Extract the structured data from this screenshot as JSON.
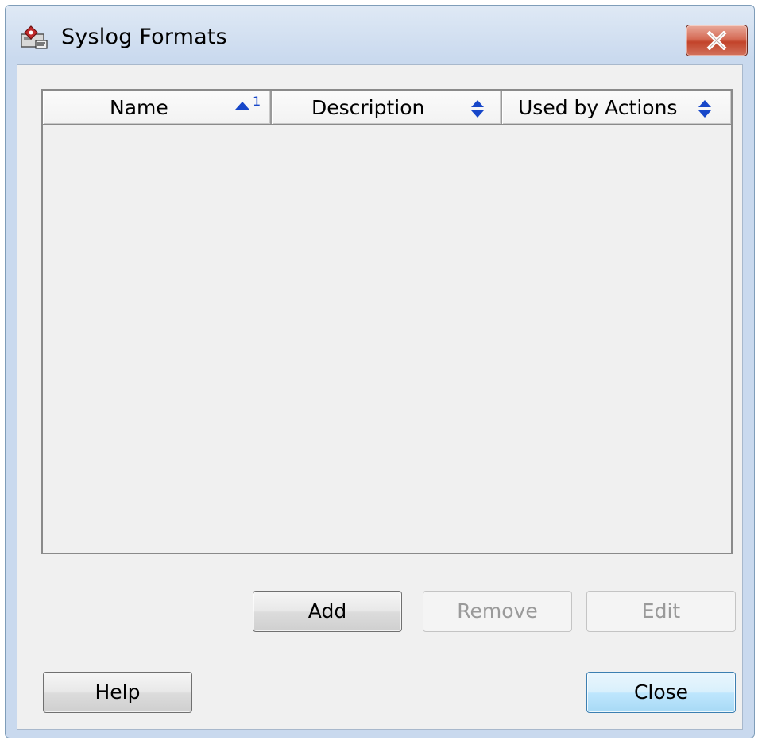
{
  "window": {
    "title": "Syslog Formats",
    "icon": "syslog-app-icon",
    "close_icon": "close-x-icon"
  },
  "table": {
    "columns": [
      {
        "label": "Name",
        "sort_icon": "sort-ascending-icon",
        "sort_rank": "1"
      },
      {
        "label": "Description",
        "sort_icon": "sort-both-icon"
      },
      {
        "label": "Used by Actions",
        "sort_icon": "sort-both-icon"
      }
    ],
    "rows": []
  },
  "buttons": {
    "add": "Add",
    "remove": "Remove",
    "edit": "Edit",
    "help": "Help",
    "close": "Close"
  },
  "colors": {
    "sort_icon": "#1747c9",
    "close_button": "#c2432a",
    "primary_button": "#bee6fd"
  }
}
